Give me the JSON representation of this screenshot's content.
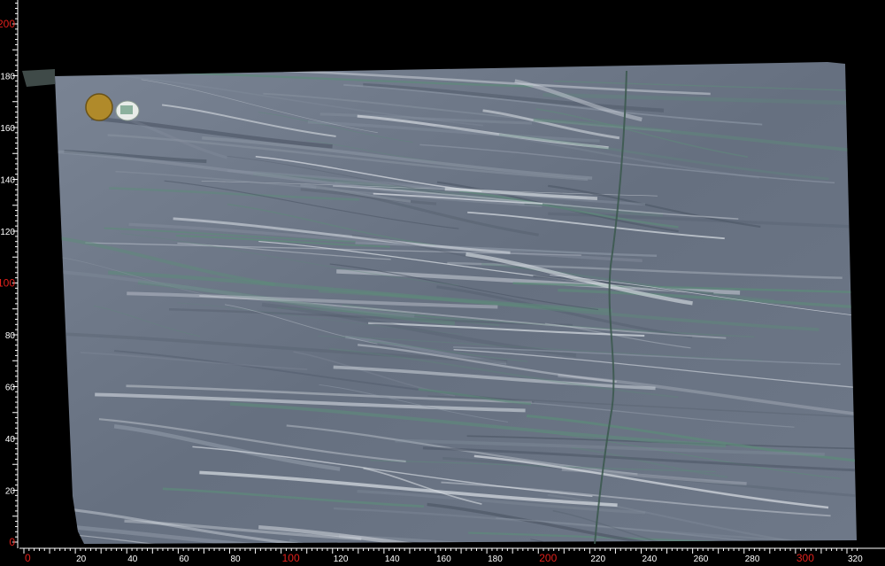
{
  "image": {
    "subject": "Natural stone slab photographed on black background with measurement rulers",
    "background_color": "#000000",
    "slab_base_color": "#6b7585",
    "vein_color_light": "#d8dde3",
    "vein_color_green": "#5e8a7a",
    "ruler_color": "#ffffff",
    "major_label_color": "#e0201b"
  },
  "rulers": {
    "x_axis": {
      "start": 0,
      "end": 320,
      "step": 20,
      "labels": [
        "0",
        "20",
        "40",
        "60",
        "80",
        "100",
        "120",
        "140",
        "160",
        "180",
        "200",
        "220",
        "240",
        "260",
        "280",
        "300",
        "320"
      ],
      "major_labels": [
        "0",
        "100",
        "200",
        "300"
      ]
    },
    "y_axis": {
      "start": 0,
      "end": 200,
      "step": 20,
      "labels": [
        "0",
        "20",
        "40",
        "60",
        "80",
        "100",
        "120",
        "140",
        "160",
        "180",
        "200"
      ],
      "major_labels": [
        "0",
        "100",
        "200"
      ]
    }
  },
  "stickers": [
    {
      "name": "gold-round-sticker",
      "color": "#b08a2a"
    },
    {
      "name": "white-label-sticker",
      "color": "#e8ece8"
    }
  ]
}
